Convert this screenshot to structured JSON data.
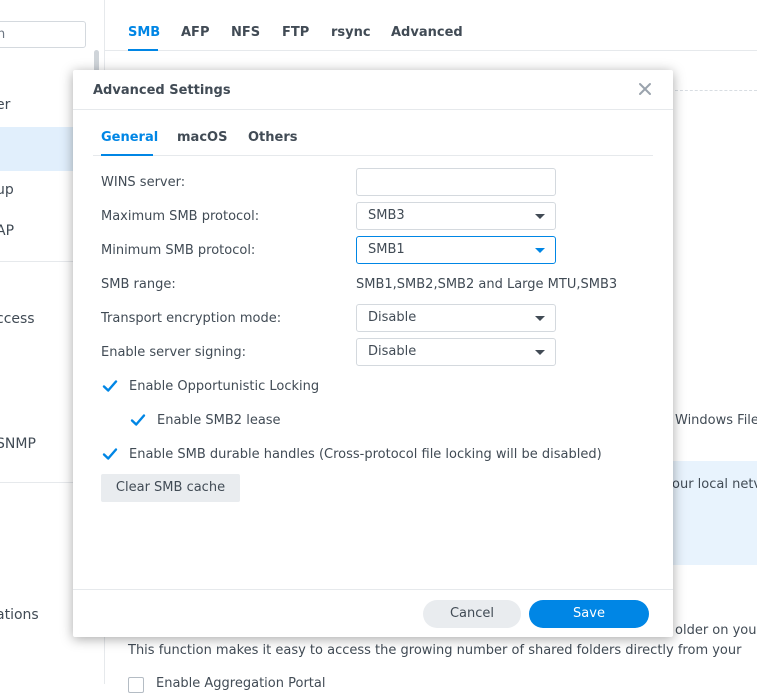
{
  "app": {
    "sidebar": {
      "search_placeholder": "h",
      "items": [
        "er",
        "up",
        "AP",
        "ccess",
        "SNMP",
        "ations"
      ]
    },
    "tabs": [
      "SMB",
      "AFP",
      "NFS",
      "FTP",
      "rsync",
      "Advanced"
    ],
    "active_tab": "SMB",
    "background_text": {
      "windows_file": "Windows File",
      "local_net": "our local netv",
      "folder_on": "older on your",
      "aggregation_desc": "This function makes it easy to access the growing number of shared folders directly from your",
      "aggregation_checkbox": "Enable Aggregation Portal"
    }
  },
  "dialog": {
    "title": "Advanced Settings",
    "tabs": [
      "General",
      "macOS",
      "Others"
    ],
    "active_tab": "General",
    "fields": {
      "wins_label": "WINS server:",
      "wins_value": "",
      "max_smb_label": "Maximum SMB protocol:",
      "max_smb_value": "SMB3",
      "min_smb_label": "Minimum SMB protocol:",
      "min_smb_value": "SMB1",
      "range_label": "SMB range:",
      "range_value": "SMB1,SMB2,SMB2 and Large MTU,SMB3",
      "encryption_label": "Transport encryption mode:",
      "encryption_value": "Disable",
      "signing_label": "Enable server signing:",
      "signing_value": "Disable"
    },
    "checkboxes": {
      "oplock": "Enable Opportunistic Locking",
      "smb2_lease": "Enable SMB2 lease",
      "durable": "Enable SMB durable handles (Cross-protocol file locking will be disabled)"
    },
    "buttons": {
      "clear_cache": "Clear SMB cache",
      "cancel": "Cancel",
      "save": "Save"
    },
    "colors": {
      "accent": "#0086e5",
      "text": "#414b55"
    }
  }
}
